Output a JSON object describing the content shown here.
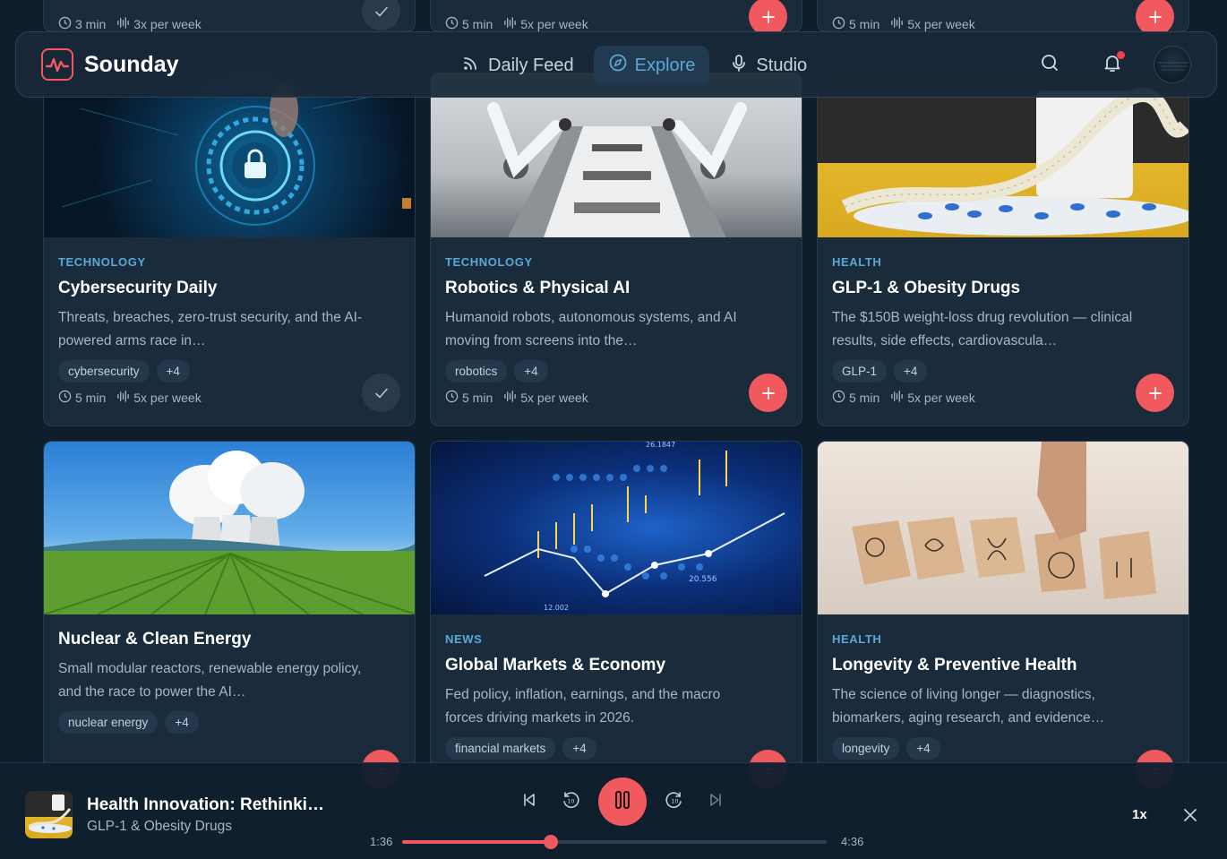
{
  "app": {
    "name": "Sounday"
  },
  "nav": {
    "tabs": [
      {
        "label": "Daily Feed",
        "icon": "rss-icon",
        "active": false
      },
      {
        "label": "Explore",
        "icon": "compass-icon",
        "active": true
      },
      {
        "label": "Studio",
        "icon": "microphone-icon",
        "active": false
      }
    ],
    "notifications_unread": true
  },
  "top_row": [
    {
      "duration": "3 min",
      "frequency": "3x per week",
      "added": true
    },
    {
      "duration": "5 min",
      "frequency": "5x per week",
      "added": false
    },
    {
      "duration": "5 min",
      "frequency": "5x per week",
      "added": false
    }
  ],
  "cards": [
    {
      "category": "TECHNOLOGY",
      "title": "Cybersecurity Daily",
      "description": "Threats, breaches, zero-trust security, and the AI-powered arms race in…",
      "tag": "cybersecurity",
      "more": "+4",
      "duration": "5 min",
      "frequency": "5x per week",
      "added": true
    },
    {
      "category": "TECHNOLOGY",
      "title": "Robotics & Physical AI",
      "description": "Humanoid robots, autonomous systems, and AI moving from screens into the…",
      "tag": "robotics",
      "more": "+4",
      "duration": "5 min",
      "frequency": "5x per week",
      "added": false
    },
    {
      "category": "HEALTH",
      "title": "GLP-1 & Obesity Drugs",
      "description": "The $150B weight-loss drug revolution — clinical results, side effects, cardiovascula…",
      "tag": "GLP-1",
      "more": "+4",
      "duration": "5 min",
      "frequency": "5x per week",
      "added": false
    },
    {
      "category": "",
      "title": "Nuclear & Clean Energy",
      "description": "Small modular reactors, renewable energy policy, and the race to power the AI…",
      "tag": "nuclear energy",
      "more": "+4"
    },
    {
      "category": "NEWS",
      "title": "Global Markets & Economy",
      "description": "Fed policy, inflation, earnings, and the macro forces driving markets in 2026.",
      "tag": "financial markets",
      "more": "+4"
    },
    {
      "category": "HEALTH",
      "title": "Longevity & Preventive Health",
      "description": "The science of living longer — diagnostics, biomarkers, aging research, and evidence…",
      "tag": "longevity",
      "more": "+4"
    }
  ],
  "chart_overlay": {
    "labels": [
      "20.556",
      "12.002",
      "26.1847"
    ]
  },
  "player": {
    "title": "Health Innovation: Rethinki…",
    "subtitle": "GLP-1 & Obesity Drugs",
    "elapsed": "1:36",
    "total": "4:36",
    "progress": 0.35,
    "speed": "1x",
    "playing": true
  },
  "colors": {
    "accent": "#f0595e",
    "category": "#5aa8d8",
    "background": "#0e1e2d",
    "card": "#1a2b3c"
  }
}
